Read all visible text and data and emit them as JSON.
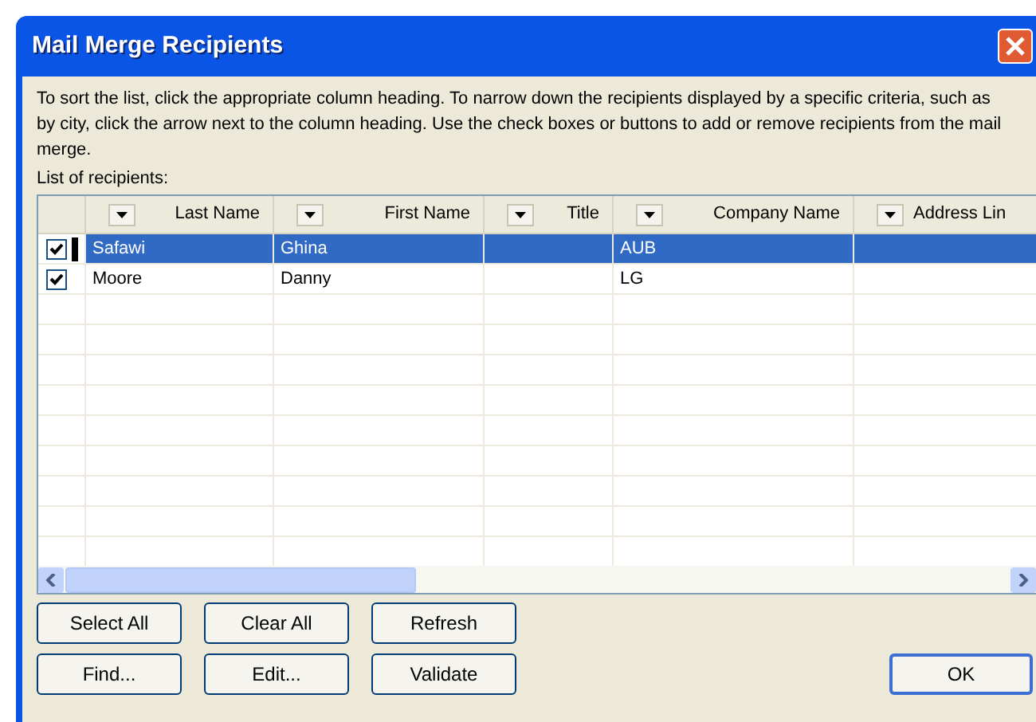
{
  "window": {
    "title": "Mail Merge Recipients"
  },
  "instructions": "To sort the list, click the appropriate column heading.  To narrow down the recipients displayed by a specific criteria, such as by city, click the arrow next to the column heading.  Use the check boxes or buttons to add or remove recipients from the mail merge.",
  "list_label": "List of recipients:",
  "table": {
    "columns": [
      "Last Name",
      "First Name",
      "Title",
      "Company Name",
      "Address Lin"
    ],
    "rows": [
      {
        "cells": [
          "Safawi",
          "Ghina",
          "",
          "AUB",
          ""
        ],
        "checked": true,
        "selected": true
      },
      {
        "cells": [
          "Moore",
          "Danny",
          "",
          "LG",
          ""
        ],
        "checked": true,
        "selected": false
      }
    ]
  },
  "buttons": [
    [
      "Select All",
      "Clear All",
      "Refresh"
    ],
    [
      "Find...",
      "Edit...",
      "Validate"
    ]
  ],
  "ok_button": "OK"
}
